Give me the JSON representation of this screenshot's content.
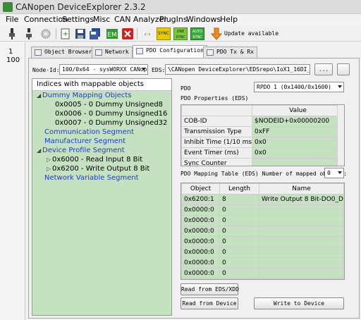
{
  "window": {
    "title": "CANopen DeviceExplorer 2.3.2"
  },
  "menu": [
    "File",
    "Connection",
    "Settings",
    "Misc",
    "CAN Analyzer",
    "PlugIns",
    "Windows",
    "Help"
  ],
  "toolbar": {
    "update_label": "Update available",
    "sync_label": "SYNC",
    "one_sync_label": "ONE SYNC",
    "auto_sync_label": "AUTO SYNC"
  },
  "gutter": [
    "1",
    "100"
  ],
  "tabs": [
    "Object Browser",
    "Network",
    "PDO Configuration",
    "PDO Tx & Rx"
  ],
  "node": {
    "label": "Node-Id:",
    "value": "100/0x64 - sysWORXX CANopen",
    "eds_label": "EDS:",
    "eds_value": "\\CANopen DeviceExplorer\\EDSrepo\\IoX1_16DI_8DO.eds",
    "browse_label": "..."
  },
  "tree": {
    "header": "Indices with mappable objects",
    "items": [
      {
        "label": "Dummy Mapping Objects",
        "level": 0,
        "link": true,
        "expander": "open"
      },
      {
        "label": "0x0005 - 0 Dummy Unsigned8",
        "level": 1,
        "link": false
      },
      {
        "label": "0x0006 - 0 Dummy Unsigned16",
        "level": 1,
        "link": false
      },
      {
        "label": "0x0007 - 0 Dummy Unsigned32",
        "level": 1,
        "link": false
      },
      {
        "label": "Communication Segment",
        "level": 0,
        "link": true
      },
      {
        "label": "Manufacturer Segment",
        "level": 0,
        "link": true
      },
      {
        "label": "Device Profile Segment",
        "level": 0,
        "link": true,
        "expander": "open"
      },
      {
        "label": "0x6000 - Read Input 8 Bit",
        "level": 1,
        "link": false,
        "expander": "closed"
      },
      {
        "label": "0x6200 - Write Output 8 Bit",
        "level": 1,
        "link": false,
        "expander": "closed"
      },
      {
        "label": "Network Variable Segment",
        "level": 0,
        "link": true
      }
    ]
  },
  "pdo": {
    "label": "PDO",
    "select": "RPDO   1 (0x1400/0x1600)"
  },
  "properties": {
    "title": "PDO Properties (EDS)",
    "value_header": "Value",
    "rows": [
      {
        "name": "COB-ID",
        "value": "$NODEID+0x00000200"
      },
      {
        "name": "Transmission Type",
        "value": "0xFF"
      },
      {
        "name": "Inhibit Time (1/10 ms)",
        "value": "0x0"
      },
      {
        "name": "Event Timer (ms)",
        "value": "0x0"
      },
      {
        "name": "Sync Counter",
        "value": ""
      }
    ]
  },
  "mapping": {
    "title": "PDO Mapping Table (EDS) Number of mapped objects:",
    "count": "0",
    "headers": [
      "Object",
      "Length",
      "Name"
    ],
    "rows": [
      {
        "object": "0x6200:1",
        "length": "8",
        "name": "Write Output 8 Bit-DO0_DO7"
      },
      {
        "object": "0x0000:0",
        "length": "0",
        "name": ""
      },
      {
        "object": "0x0000:0",
        "length": "0",
        "name": ""
      },
      {
        "object": "0x0000:0",
        "length": "0",
        "name": ""
      },
      {
        "object": "0x0000:0",
        "length": "0",
        "name": ""
      },
      {
        "object": "0x0000:0",
        "length": "0",
        "name": ""
      },
      {
        "object": "0x0000:0",
        "length": "0",
        "name": ""
      },
      {
        "object": "0x0000:0",
        "length": "0",
        "name": ""
      }
    ]
  },
  "buttons": {
    "read_eds": "Read from EDS/XDD",
    "read_device": "Read from Device",
    "write_device": "Write to Device"
  },
  "colors": {
    "mapped_green": "#c5e1c1",
    "link_blue": "#1a3fc4"
  }
}
